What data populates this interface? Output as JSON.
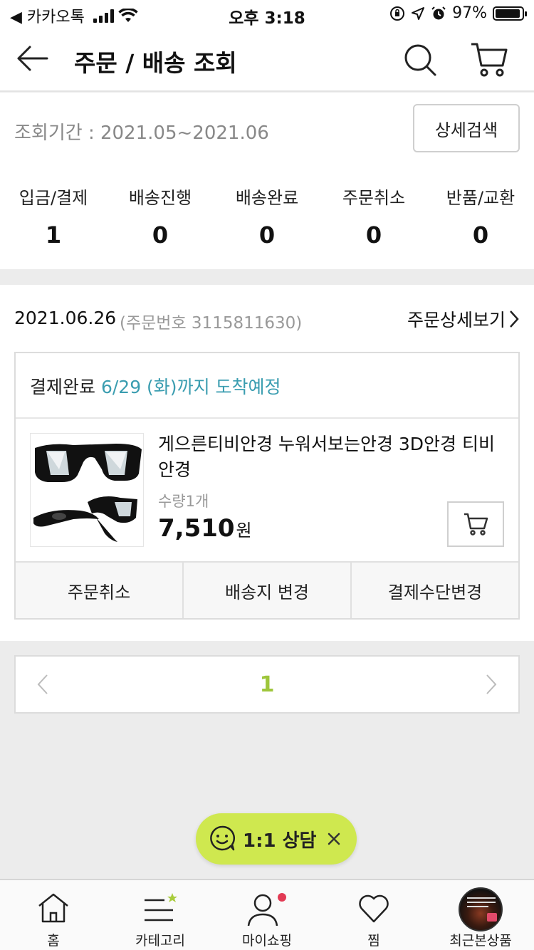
{
  "status_bar": {
    "carrier": "◀ 카카오톡",
    "time": "오후 3:18",
    "battery": "97%"
  },
  "header": {
    "title": "주문 / 배송 조회",
    "icons": [
      "back-arrow-icon",
      "search-icon",
      "cart-icon"
    ]
  },
  "filter": {
    "period": "조회기간 : 2021.05~2021.06",
    "detail_search": "상세검색"
  },
  "stats": [
    {
      "label": "입금/결제",
      "count": "1"
    },
    {
      "label": "배송진행",
      "count": "0"
    },
    {
      "label": "배송완료",
      "count": "0"
    },
    {
      "label": "주문취소",
      "count": "0"
    },
    {
      "label": "반품/교환",
      "count": "0"
    }
  ],
  "order": {
    "date": "2021.06.26",
    "order_no": "(주문번호 3115811630)",
    "detail_link": "주문상세보기",
    "status": "결제완료",
    "eta": "6/29 (화)까지 도착예정",
    "product_name": "게으른티비안경 누워서보는안경 3D안경 티비안경",
    "quantity": "수량1개",
    "price": "7,510",
    "currency": "원",
    "actions": [
      "주문취소",
      "배송지 변경",
      "결제수단변경"
    ]
  },
  "pagination": {
    "current_page": "1"
  },
  "chat": {
    "label": "1:1 상담"
  },
  "tabbar": [
    {
      "label": "홈",
      "icon": "home-icon"
    },
    {
      "label": "카테고리",
      "icon": "category-icon"
    },
    {
      "label": "마이쇼핑",
      "icon": "user-icon"
    },
    {
      "label": "찜",
      "icon": "heart-icon"
    },
    {
      "label": "최근본상품",
      "icon": "recent-product-thumbnail"
    }
  ],
  "colors": {
    "eta": "#3a9db0",
    "page_active": "#9ec63b",
    "chat_bg": "#cfe84f",
    "notification_dot": "#e23a54"
  }
}
